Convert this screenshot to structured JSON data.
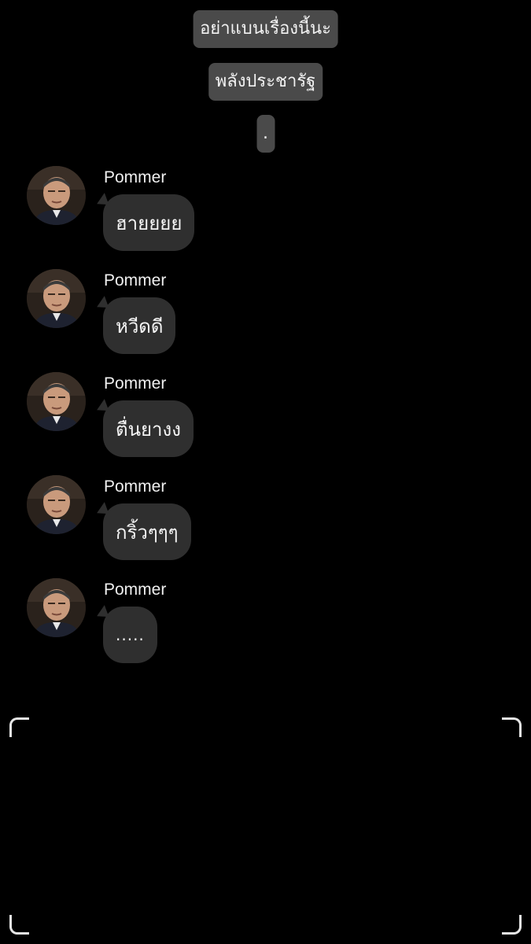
{
  "system_messages": [
    {
      "text": "อย่าแบนเรื่องนี้นะ"
    },
    {
      "text": "พลังประชารัฐ"
    },
    {
      "text": "."
    }
  ],
  "messages": [
    {
      "sender": "Pommer",
      "text": "ฮายยยย",
      "avatar_icon": "profile-photo"
    },
    {
      "sender": "Pommer",
      "text": "หวีดดี",
      "avatar_icon": "profile-photo"
    },
    {
      "sender": "Pommer",
      "text": "ตื่นยางง",
      "avatar_icon": "profile-photo"
    },
    {
      "sender": "Pommer",
      "text": "กริ้วๆๆๆ",
      "avatar_icon": "profile-photo"
    },
    {
      "sender": "Pommer",
      "text": ".....",
      "avatar_icon": "profile-photo"
    }
  ],
  "colors": {
    "background": "#000000",
    "system_pill": "#4a4a4a",
    "bubble": "#2f2f2f",
    "text": "#ffffff"
  }
}
